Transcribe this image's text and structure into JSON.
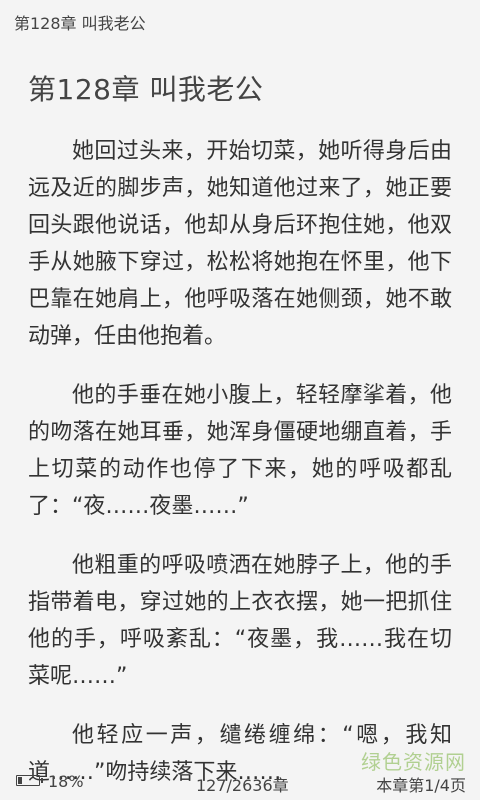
{
  "header": {
    "chapter_label": "第128章 叫我老公"
  },
  "chapter": {
    "title": "第128章 叫我老公"
  },
  "paragraphs": [
    "她回过头来，开始切菜，她听得身后由远及近的脚步声，她知道他过来了，她正要回头跟他说话，他却从身后环抱住她，他双手从她腋下穿过，松松将她抱在怀里，他下巴靠在她肩上，他呼吸落在她侧颈，她不敢动弹，任由他抱着。",
    "他的手垂在她小腹上，轻轻摩挲着，他的吻落在她耳垂，她浑身僵硬地绷直着，手上切菜的动作也停了下来，她的呼吸都乱了：“夜……夜墨……”",
    "他粗重的呼吸喷洒在她脖子上，他的手指带着电，穿过她的上衣衣摆，她一把抓住他的手，呼吸紊乱：“夜墨，我……我在切菜呢……”",
    "他轻应一声，缱绻缠绵：“嗯，我知道……”吻持续落下来……"
  ],
  "footer": {
    "battery_percent": "18%",
    "battery_level": 0.18,
    "chapter_progress": "127/2636章",
    "page_in_chapter": "本章第1/4页"
  },
  "watermark": {
    "text": "绿色资源网",
    "color": "#7cb342"
  }
}
